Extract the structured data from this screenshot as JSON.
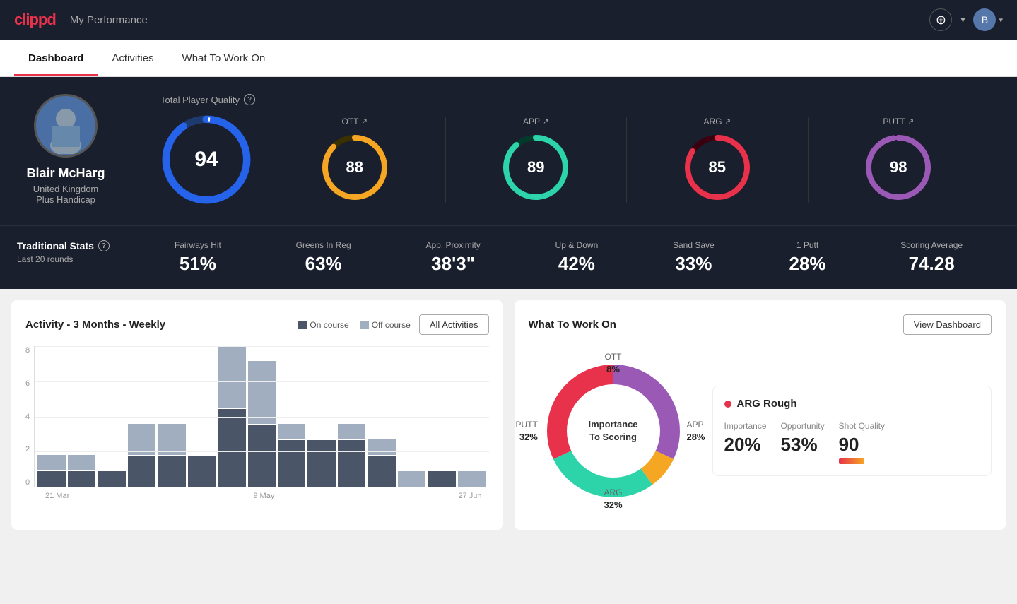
{
  "header": {
    "logo": "clippd",
    "title": "My Performance",
    "add_icon": "+",
    "chevron_icon": "▾"
  },
  "nav": {
    "tabs": [
      {
        "label": "Dashboard",
        "active": true
      },
      {
        "label": "Activities",
        "active": false
      },
      {
        "label": "What To Work On",
        "active": false
      }
    ]
  },
  "player": {
    "name": "Blair McHarg",
    "country": "United Kingdom",
    "handicap": "Plus Handicap"
  },
  "quality": {
    "title": "Total Player Quality",
    "main_score": "94",
    "metrics": [
      {
        "label": "OTT",
        "value": "88",
        "color": "#f5a623",
        "track_color": "#3a3000"
      },
      {
        "label": "APP",
        "value": "89",
        "color": "#2dd4aa",
        "track_color": "#003a2a"
      },
      {
        "label": "ARG",
        "value": "85",
        "color": "#e8314a",
        "track_color": "#3a0010"
      },
      {
        "label": "PUTT",
        "value": "98",
        "color": "#9b59b6",
        "track_color": "#2a003a"
      }
    ]
  },
  "traditional_stats": {
    "title": "Traditional Stats",
    "subtitle": "Last 20 rounds",
    "items": [
      {
        "label": "Fairways Hit",
        "value": "51%"
      },
      {
        "label": "Greens In Reg",
        "value": "63%"
      },
      {
        "label": "App. Proximity",
        "value": "38'3\""
      },
      {
        "label": "Up & Down",
        "value": "42%"
      },
      {
        "label": "Sand Save",
        "value": "33%"
      },
      {
        "label": "1 Putt",
        "value": "28%"
      },
      {
        "label": "Scoring Average",
        "value": "74.28"
      }
    ]
  },
  "activity_chart": {
    "title": "Activity - 3 Months - Weekly",
    "legend": [
      {
        "label": "On course",
        "color": "#4a5568"
      },
      {
        "label": "Off course",
        "color": "#a0aec0"
      }
    ],
    "all_activities_label": "All Activities",
    "x_labels": [
      "21 Mar",
      "9 May",
      "27 Jun"
    ],
    "y_labels": [
      "0",
      "2",
      "4",
      "6",
      "8"
    ],
    "bars": [
      {
        "on": 1,
        "off": 1
      },
      {
        "on": 1,
        "off": 1
      },
      {
        "on": 1,
        "off": 0
      },
      {
        "on": 2,
        "off": 2
      },
      {
        "on": 2,
        "off": 2
      },
      {
        "on": 2,
        "off": 0
      },
      {
        "on": 5,
        "off": 4
      },
      {
        "on": 4,
        "off": 4
      },
      {
        "on": 3,
        "off": 1
      },
      {
        "on": 3,
        "off": 0
      },
      {
        "on": 3,
        "off": 1
      },
      {
        "on": 2,
        "off": 1
      },
      {
        "on": 0,
        "off": 1
      },
      {
        "on": 1,
        "off": 0
      },
      {
        "on": 0,
        "off": 1
      }
    ]
  },
  "work_on": {
    "title": "What To Work On",
    "view_dashboard_label": "View Dashboard",
    "donut": {
      "center_text": "Importance\nTo Scoring",
      "segments": [
        {
          "label": "OTT",
          "pct": "8%",
          "color": "#f5a623",
          "value": 8
        },
        {
          "label": "APP",
          "pct": "28%",
          "color": "#2dd4aa",
          "value": 28
        },
        {
          "label": "ARG",
          "pct": "32%",
          "color": "#e8314a",
          "value": 32
        },
        {
          "label": "PUTT",
          "pct": "32%",
          "color": "#9b59b6",
          "value": 32
        }
      ]
    },
    "detail": {
      "title": "ARG Rough",
      "dot_color": "#e8314a",
      "metrics": [
        {
          "label": "Importance",
          "value": "20%"
        },
        {
          "label": "Opportunity",
          "value": "53%"
        },
        {
          "label": "Shot Quality",
          "value": "90"
        }
      ]
    }
  }
}
